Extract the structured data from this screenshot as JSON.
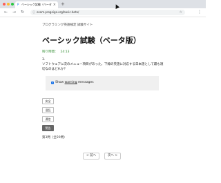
{
  "browser": {
    "dot_colors": [
      "#ff5f57",
      "#febc2e",
      "#28c840"
    ],
    "tab": {
      "title": "ベーシック試験（ベータ版）| プ",
      "favicon": "P",
      "close": "×"
    },
    "new_tab": "+",
    "nav": {
      "back": "←",
      "forward": "→",
      "reload": "↻"
    },
    "url": "exam.progeigo.org/basic-beta/",
    "lock": "ⓘ",
    "bookmark": "☆",
    "menu": "⋮"
  },
  "page": {
    "breadcrumb": "プログラミング英語検定 試験サイト",
    "title": "ベーシック試験（ベータ版）",
    "timer_label": "残り時間：",
    "timer_value": "24:13",
    "question_number": "3.",
    "question_text": "ソフトウェアに次のメニュー項目があった。下線の英語に対応する日本語として最も適切なのはどれか？",
    "warning_checkbox": {
      "checked": true,
      "label_before": "Show ",
      "label_underlined": "warning",
      "label_after": " messages"
    },
    "options": [
      {
        "label": "安全",
        "selected": false
      },
      {
        "label": "混乱",
        "selected": false
      },
      {
        "label": "通信",
        "selected": false
      },
      {
        "label": "警告",
        "selected": true
      }
    ],
    "answered_count": "第3問（全20問）",
    "prev_button": "< 前へ",
    "next_button": "次へ >"
  }
}
